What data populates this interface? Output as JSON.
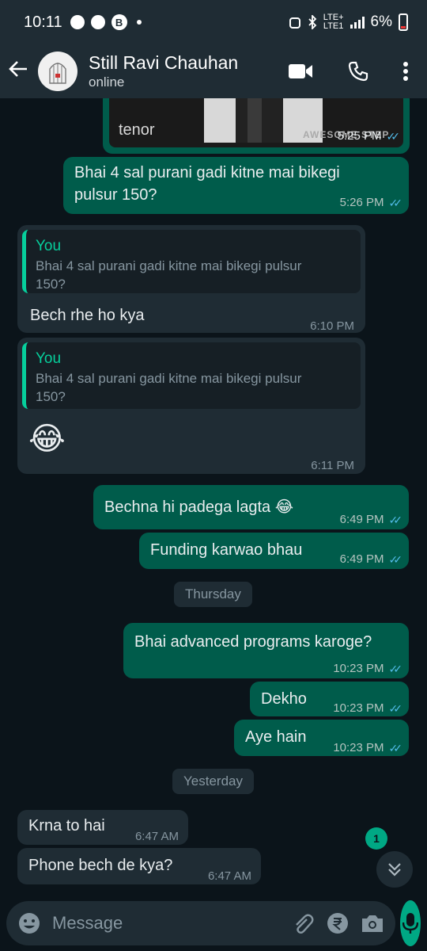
{
  "status_bar": {
    "time": "10:11",
    "battery": "6%",
    "network": "LTE+",
    "network2": "LTE1"
  },
  "header": {
    "contact_name": "Still Ravi Chauhan",
    "contact_status": "online"
  },
  "messages": [
    {
      "type": "gif",
      "label": "tenor",
      "gif_caption": "AWESOME STEP",
      "time": "5:25 PM",
      "direction": "out"
    },
    {
      "type": "text",
      "direction": "out",
      "lines": [
        "Bhai 4 sal purani gadi kitne mai bikegi",
        "pulsur 150?"
      ],
      "time": "5:26 PM"
    },
    {
      "type": "reply",
      "direction": "in",
      "quote_author": "You",
      "quote_text": [
        "Bhai 4 sal purani gadi kitne mai bikegi pulsur",
        "150?"
      ],
      "text": "Bech rhe ho kya",
      "time": "6:10 PM"
    },
    {
      "type": "reply",
      "direction": "in",
      "quote_author": "You",
      "quote_text": [
        "Bhai 4 sal purani gadi kitne mai bikegi pulsur",
        "150?"
      ],
      "text": "😂",
      "time": "6:11 PM"
    },
    {
      "type": "text",
      "direction": "out",
      "text": "Bechna hi padega lagta 😂",
      "time": "6:49 PM"
    },
    {
      "type": "text",
      "direction": "out",
      "text": "Funding karwao bhau",
      "time": "6:49 PM"
    },
    {
      "type": "day",
      "text": "Thursday"
    },
    {
      "type": "text",
      "direction": "out",
      "text": "Bhai advanced programs karoge?",
      "time": "10:23 PM"
    },
    {
      "type": "text",
      "direction": "out",
      "text": "Dekho",
      "time": "10:23 PM"
    },
    {
      "type": "text",
      "direction": "out",
      "text": "Aye hain",
      "time": "10:23 PM"
    },
    {
      "type": "day",
      "text": "Yesterday"
    },
    {
      "type": "text",
      "direction": "in",
      "text": "Krna to hai",
      "time": "6:47 AM"
    },
    {
      "type": "text",
      "direction": "in",
      "text": "Phone bech de kya?",
      "time": "6:47 AM"
    }
  ],
  "unread_badge": "1",
  "input": {
    "placeholder": "Message"
  },
  "colors": {
    "outgoing_bubble": "#005c4b",
    "incoming_bubble": "#1f2c34",
    "accent": "#00a884",
    "read_ticks": "#53bdeb"
  },
  "icons": [
    "back-arrow-icon",
    "video-call-icon",
    "phone-icon",
    "more-vertical-icon",
    "emoji-icon",
    "attach-icon",
    "rupee-icon",
    "camera-icon",
    "mic-icon",
    "chevron-double-down-icon"
  ]
}
